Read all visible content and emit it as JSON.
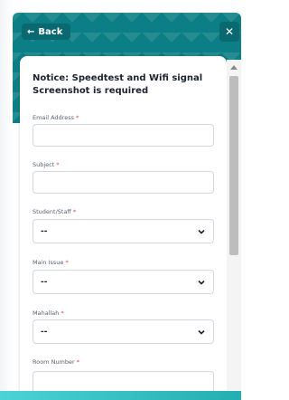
{
  "header": {
    "back_label": "Back",
    "close_label": "✕"
  },
  "form": {
    "notice": "Notice: Speedtest and Wifi signal Screenshot is required",
    "required_marker": "*",
    "fields": [
      {
        "label": "Email Address",
        "value": ""
      },
      {
        "label": "Subject",
        "value": ""
      },
      {
        "label": "Student/Staff",
        "value": "--"
      },
      {
        "label": "Main Issue",
        "value": "--"
      },
      {
        "label": "Mahallah",
        "value": "--"
      },
      {
        "label": "Room Number",
        "value": ""
      }
    ]
  },
  "colors": {
    "accent": "#0c7f86",
    "required": "#e53935"
  },
  "icons": {
    "back": "arrow-left-icon",
    "close": "close-icon",
    "dropdown": "chevron-down-icon",
    "scroll_up": "scroll-up-arrow-icon"
  }
}
